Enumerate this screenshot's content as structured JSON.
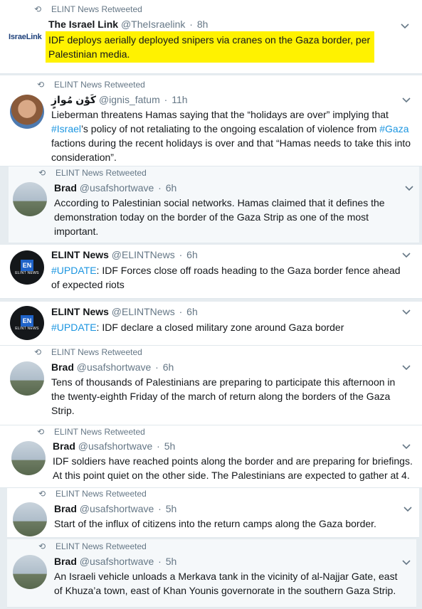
{
  "retweet_label": "ELINT News Retweeted",
  "tweets": [
    {
      "name": "The Israel Link",
      "handle": "@TheIsraelink",
      "time": "8h",
      "logo_text": "IsraeLink",
      "text": "IDF deploys aerially deployed snipers via cranes on the Gaza border, per Palestinian media.",
      "highlight_color": "#fff200"
    },
    {
      "name": "كَوْن مُوازٍ",
      "handle": "@ignis_fatum",
      "time": "11h",
      "text_parts": [
        "Lieberman threatens Hamas saying that the “holidays are over” implying that ",
        "#Israel",
        "’s policy of not retaliating to the ongoing escalation of violence from ",
        "#Gaza",
        " factions during the recent holidays is over and that “Hamas needs to take this into consideration”."
      ]
    },
    {
      "name": "Brad",
      "handle": "@usafshortwave",
      "time": "6h",
      "text": "According to Palestinian social networks. Hamas claimed that it defines the demonstration today on the border of the Gaza Strip as one of the most important."
    },
    {
      "name": "ELINT News",
      "handle": "@ELINTNews",
      "time": "6h",
      "hashtag": "#UPDATE",
      "text": ": IDF Forces close off roads heading to the Gaza border fence ahead of expected riots"
    },
    {
      "name": "ELINT News",
      "handle": "@ELINTNews",
      "time": "6h",
      "hashtag": "#UPDATE",
      "text": ": IDF declare a closed military zone around Gaza border"
    },
    {
      "name": "Brad",
      "handle": "@usafshortwave",
      "time": "6h",
      "text": "Tens of thousands of Palestinians are preparing to participate this afternoon in the twenty-eighth Friday of the march of return along the borders of the Gaza Strip."
    },
    {
      "name": "Brad",
      "handle": "@usafshortwave",
      "time": "5h",
      "text": "IDF soldiers have reached points along the border and are preparing for briefings. At this point quiet on the other side. The Palestinians are expected to gather at 4."
    },
    {
      "name": "Brad",
      "handle": "@usafshortwave",
      "time": "5h",
      "text": "Start of the influx of citizens into the return camps along the Gaza border."
    },
    {
      "name": "Brad",
      "handle": "@usafshortwave",
      "time": "5h",
      "text": "An Israeli vehicle unloads a Merkava tank in the vicinity of al-Najjar Gate, east of Khuza’a town, east of Khan Younis governorate in the southern Gaza Strip."
    }
  ],
  "avatar_en": {
    "label": "EN",
    "sub": "ELINT NEWS"
  },
  "colors": {
    "link": "#1b95e0",
    "muted": "#657786",
    "highlight": "#fff200"
  },
  "icons": {
    "retweet": "retweet-icon",
    "caret": "chevron-down-icon"
  }
}
